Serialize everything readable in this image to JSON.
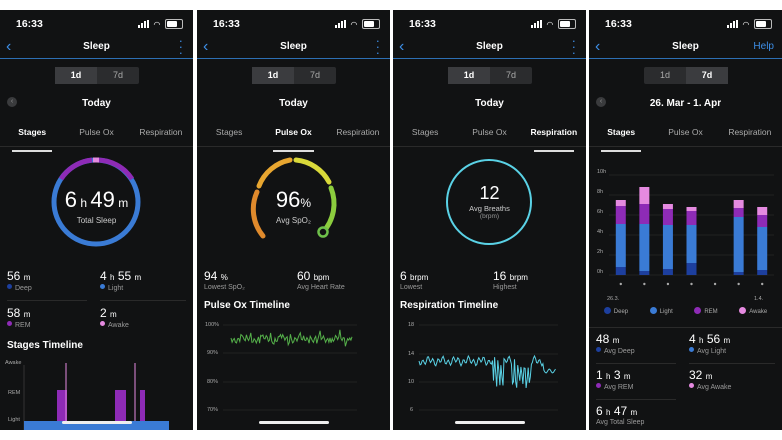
{
  "status": {
    "time": "16:33"
  },
  "colors": {
    "deep": "#1d3f9e",
    "light": "#3a7bd5",
    "rem": "#8e2bb6",
    "awake": "#e58ae0",
    "pulse": "#55b04a",
    "resp": "#5ad2e6",
    "accent": "#3d8ee6"
  },
  "screens": [
    {
      "title": "Sleep",
      "range_tabs": [
        "1d",
        "7d"
      ],
      "date": "Today",
      "tabs": [
        "Stages",
        "Pulse Ox",
        "Respiration"
      ],
      "ring": {
        "hours": "6",
        "h_unit": "h",
        "minutes": "49",
        "m_unit": "m",
        "label": "Total Sleep"
      },
      "stats": [
        {
          "value": "56",
          "unit": "m",
          "label": "Deep"
        },
        {
          "value": "4",
          "unit": "h",
          "value2": "55",
          "unit2": "m",
          "label": "Light"
        },
        {
          "value": "58",
          "unit": "m",
          "label": "REM"
        },
        {
          "value": "2",
          "unit": "m",
          "label": "Awake"
        }
      ],
      "section": "Stages Timeline",
      "axis": [
        "Awake",
        "REM",
        "Light"
      ]
    },
    {
      "title": "Sleep",
      "range_tabs": [
        "1d",
        "7d"
      ],
      "date": "Today",
      "tabs": [
        "Stages",
        "Pulse Ox",
        "Respiration"
      ],
      "ring": {
        "value": "96",
        "unit": "%",
        "label": "Avg SpO₂"
      },
      "stats": [
        {
          "value": "94",
          "unit": "%",
          "label": "Lowest SpO₂"
        },
        {
          "value": "60",
          "unit": "bpm",
          "label": "Avg Heart Rate"
        }
      ],
      "section": "Pulse Ox Timeline",
      "axis": [
        "100%",
        "90%",
        "80%",
        "70%"
      ]
    },
    {
      "title": "Sleep",
      "range_tabs": [
        "1d",
        "7d"
      ],
      "date": "Today",
      "tabs": [
        "Stages",
        "Pulse Ox",
        "Respiration"
      ],
      "ring": {
        "value": "12",
        "label": "Avg Breaths",
        "unit": "(brpm)"
      },
      "stats": [
        {
          "value": "6",
          "unit": "brpm",
          "label": "Lowest"
        },
        {
          "value": "16",
          "unit": "brpm",
          "label": "Highest"
        }
      ],
      "section": "Respiration Timeline",
      "axis": [
        "18",
        "14",
        "10",
        "6"
      ]
    },
    {
      "title": "Sleep",
      "help": "Help",
      "range_tabs": [
        "1d",
        "7d"
      ],
      "date": "26. Mar - 1. Apr",
      "tabs": [
        "Stages",
        "Pulse Ox",
        "Respiration"
      ],
      "axis": [
        "10h",
        "8h",
        "6h",
        "4h",
        "2h",
        "0h"
      ],
      "x_labels": [
        "26.3.",
        "1.4."
      ],
      "legend": [
        "Deep",
        "Light",
        "REM",
        "Awake"
      ],
      "stats": [
        {
          "value": "48",
          "unit": "m",
          "label": "Avg Deep"
        },
        {
          "value": "4",
          "unit": "h",
          "value2": "56",
          "unit2": "m",
          "label": "Avg Light"
        },
        {
          "value": "1",
          "unit": "h",
          "value2": "3",
          "unit2": "m",
          "label": "Avg REM"
        },
        {
          "value": "32",
          "unit": "m",
          "label": "Avg Awake"
        },
        {
          "value": "6",
          "unit": "h",
          "value2": "47",
          "unit2": "m",
          "label": "Avg Total Sleep"
        }
      ]
    }
  ],
  "weekly_sleep": [
    {
      "deep": 0.8,
      "light": 4.3,
      "rem": 1.8,
      "awake": 0.6
    },
    {
      "deep": 0.4,
      "light": 4.7,
      "rem": 2.0,
      "awake": 1.7
    },
    {
      "deep": 0.6,
      "light": 4.4,
      "rem": 1.6,
      "awake": 0.5
    },
    {
      "deep": 1.2,
      "light": 3.8,
      "rem": 1.4,
      "awake": 0.4
    },
    {
      "deep": 0,
      "light": 0,
      "rem": 0,
      "awake": 0
    },
    {
      "deep": 0.3,
      "light": 5.5,
      "rem": 0.9,
      "awake": 0.8
    },
    {
      "deep": 0.5,
      "light": 4.3,
      "rem": 1.2,
      "awake": 0.8
    }
  ]
}
